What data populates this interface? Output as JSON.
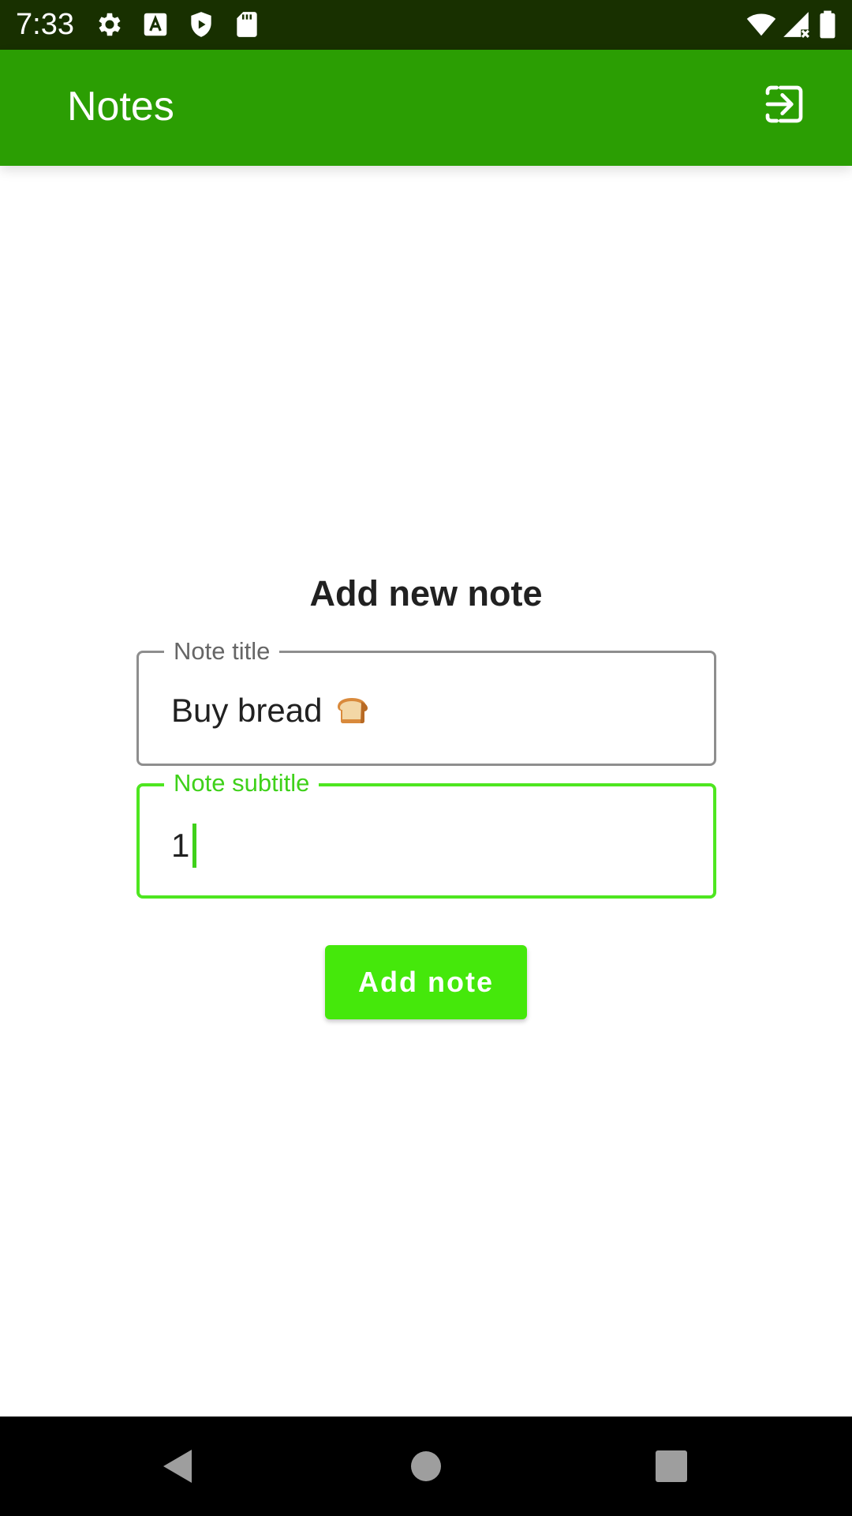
{
  "status_bar": {
    "time": "7:33",
    "left_icons": [
      "gear-icon",
      "font-a-icon",
      "play-protect-icon",
      "sd-card-icon"
    ],
    "right_icons": [
      "wifi-icon",
      "cellular-no-signal-icon",
      "battery-icon"
    ]
  },
  "app_bar": {
    "title": "Notes",
    "action_icon": "logout-icon",
    "color": "#2b9e03"
  },
  "form": {
    "heading": "Add new note",
    "title_field": {
      "label": "Note title",
      "value": "Buy bread",
      "emoji_icon": "bread-icon"
    },
    "subtitle_field": {
      "label": "Note subtitle",
      "value": "1",
      "focused": true,
      "accent": "#4ee620"
    },
    "submit_label": "Add note",
    "submit_color": "#45e80b"
  },
  "nav_bar": {
    "buttons": [
      "back-icon",
      "home-icon",
      "recents-icon"
    ]
  }
}
